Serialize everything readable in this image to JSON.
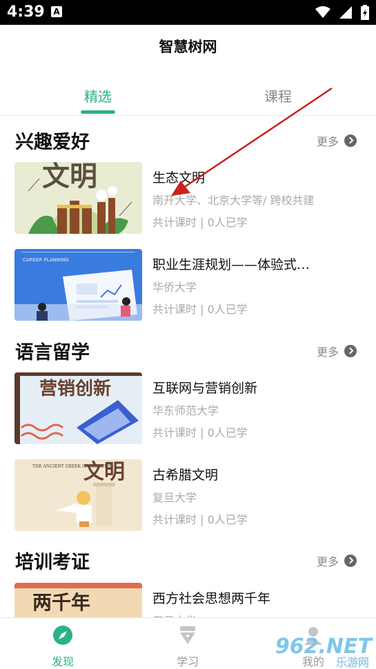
{
  "status": {
    "time": "4:39"
  },
  "header": {
    "title": "智慧树网"
  },
  "tabs": [
    {
      "label": "精选",
      "active": true
    },
    {
      "label": "课程",
      "active": false
    }
  ],
  "sections": [
    {
      "title": "兴趣爱好",
      "more_label": "更多",
      "courses": [
        {
          "title": "生态文明",
          "school": "南开大学、北京大学等/ 跨校共建",
          "stats": "共计课时 | 0人已学",
          "thumb_text": "文明"
        },
        {
          "title": "职业生涯规划——体验式…",
          "school": "华侨大学",
          "stats": "共计课时 | 0人已学",
          "thumb_text": "CAREER PLANNING"
        }
      ]
    },
    {
      "title": "语言留学",
      "more_label": "更多",
      "courses": [
        {
          "title": "互联网与营销创新",
          "school": "华东师范大学",
          "stats": "共计课时 | 0人已学",
          "thumb_text": "营销创新"
        },
        {
          "title": "古希腊文明",
          "school": "复旦大学",
          "stats": "共计课时 | 0人已学",
          "thumb_text": "文明",
          "thumb_caption": "THE ANCIENT GREEK CIVILIZATION"
        }
      ]
    },
    {
      "title": "培训考证",
      "more_label": "更多",
      "courses": [
        {
          "title": "西方社会思想两千年",
          "school": "复旦大学",
          "thumb_text": "两千年"
        }
      ]
    }
  ],
  "bottom_nav": [
    {
      "label": "发现",
      "icon": "compass-icon",
      "active": true
    },
    {
      "label": "学习",
      "icon": "pen-nib-icon",
      "active": false
    },
    {
      "label": "我的",
      "icon": "profile-icon",
      "active": false
    }
  ],
  "watermark": {
    "text": "962.NET",
    "sub": "乐游网"
  },
  "colors": {
    "accent": "#2bb18a",
    "muted": "#aaaaaa",
    "arrow": "#cc1f1f"
  }
}
